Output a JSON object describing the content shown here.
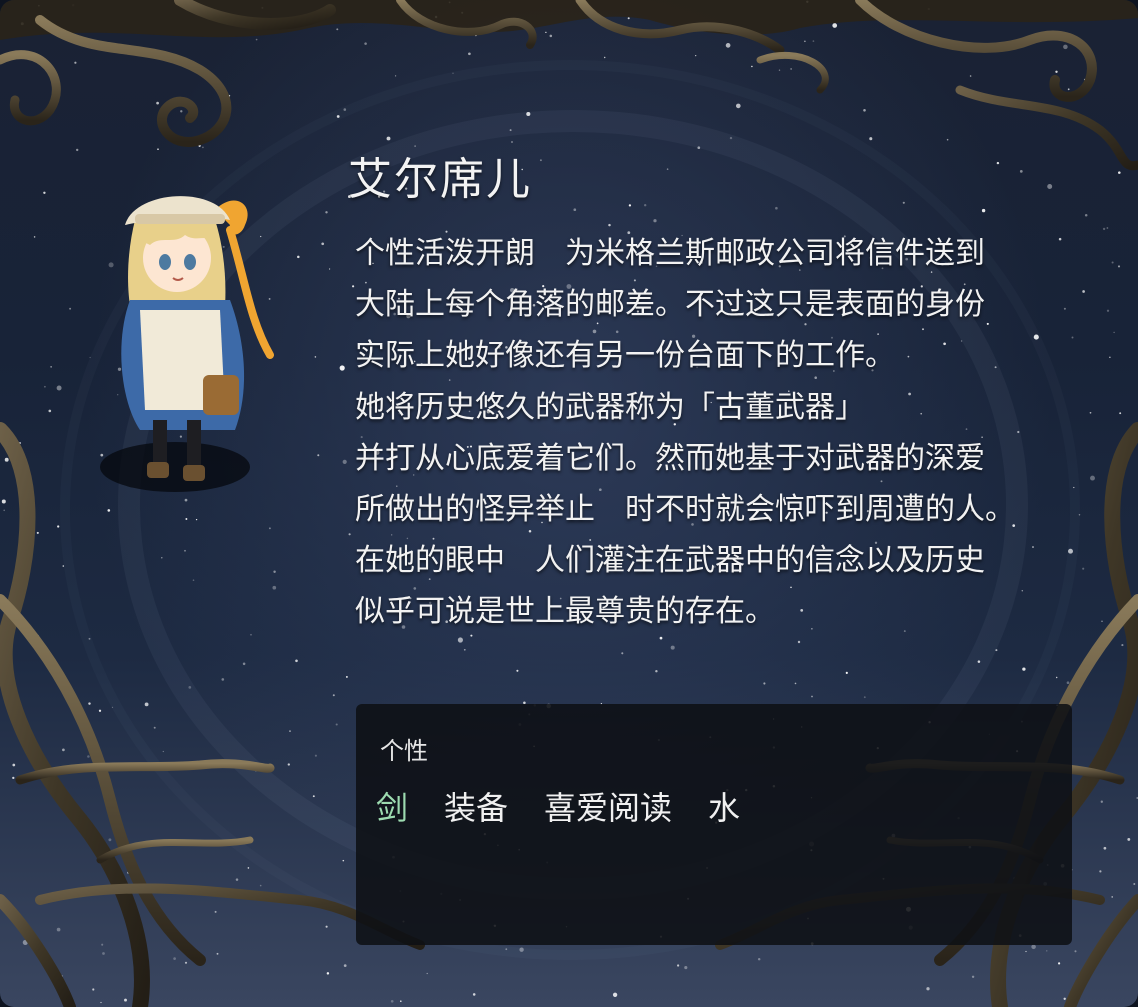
{
  "character": {
    "name": "艾尔席儿"
  },
  "description": {
    "lines": [
      "个性活泼开朗　为米格兰斯邮政公司将信件送到",
      "大陆上每个角落的邮差。不过这只是表面的身份",
      "实际上她好像还有另一份台面下的工作。",
      "她将历史悠久的武器称为「古董武器」",
      "并打从心底爱着它们。然而她基于对武器的深爱",
      "所做出的怪异举止　时不时就会惊吓到周遭的人。",
      "在她的眼中　人们灌注在武器中的信念以及历史",
      "似乎可说是世上最尊贵的存在。"
    ]
  },
  "traits": {
    "title": "个性",
    "tags": [
      "剑",
      "装备",
      "喜爱阅读",
      "水"
    ],
    "highlight_color": "#9ddbb0"
  },
  "icons": {
    "character_sprite": "chibi-mail-girl-sprite",
    "frame": "ornate-bronze-branch-frame"
  }
}
